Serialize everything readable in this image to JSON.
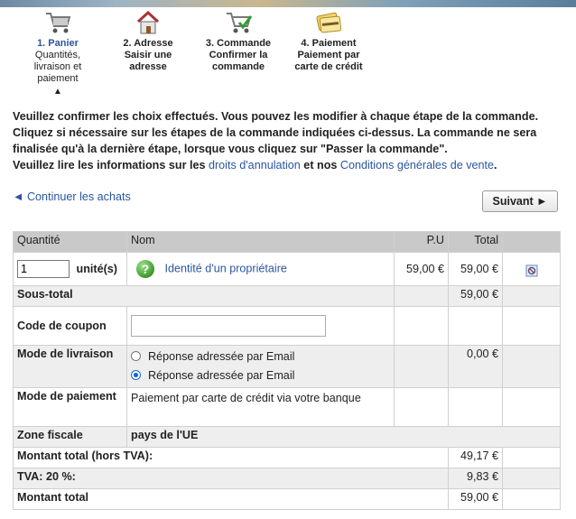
{
  "steps": [
    {
      "title": "1. Panier",
      "sub": "Quantités, livraison et paiement"
    },
    {
      "title": "2. Adresse",
      "sub": "Saisir une adresse"
    },
    {
      "title": "3. Commande",
      "sub": "Confirmer la commande"
    },
    {
      "title": "4. Paiement",
      "sub": "Paiement par carte de crédit"
    }
  ],
  "steps_caret": "▲",
  "intro": {
    "p1": "Veuillez confirmer les choix effectués. Vous pouvez les modifier à chaque étape de la commande. Cliquez si nécessaire sur les étapes de la commande indiquées ci-dessus. La commande ne sera finalisée qu'à la dernière étape, lorsque vous cliquez sur \"Passer la commande\".",
    "p2_before": "Veuillez lire les informations sur les ",
    "link_cancel": "droits d'annulation",
    "p2_mid": " et nos ",
    "link_cgv": "Conditions générales de vente",
    "p2_end": "."
  },
  "nav": {
    "continue": "◄ Continuer les achats",
    "next": "Suivant ►"
  },
  "table": {
    "headers": {
      "qty": "Quantité",
      "name": "Nom",
      "pu": "P.U",
      "total": "Total"
    },
    "item": {
      "qty": "1",
      "unit": "unité(s)",
      "name": "Identité d'un propriétaire",
      "pu": "59,00 €",
      "total": "59,00 €"
    },
    "subtotal": {
      "label": "Sous-total",
      "value": "59,00 €"
    },
    "coupon": {
      "label": "Code de coupon",
      "value": ""
    },
    "shipping": {
      "label": "Mode de livraison",
      "options": [
        "Réponse adressée par Email",
        "Réponse adressée par Email"
      ],
      "selected": 1,
      "value": "0,00 €"
    },
    "payment": {
      "label": "Mode de paiement",
      "value": "Paiement par carte de crédit via votre banque"
    },
    "tax_zone": {
      "label": "Zone fiscale",
      "value": "pays de l'UE"
    },
    "net": {
      "label": "Montant total (hors TVA):",
      "value": "49,17 €"
    },
    "vat": {
      "label": "TVA: 20 %:",
      "value": "9,83 €"
    },
    "grand": {
      "label": "Montant total",
      "value": "59,00 €"
    }
  }
}
